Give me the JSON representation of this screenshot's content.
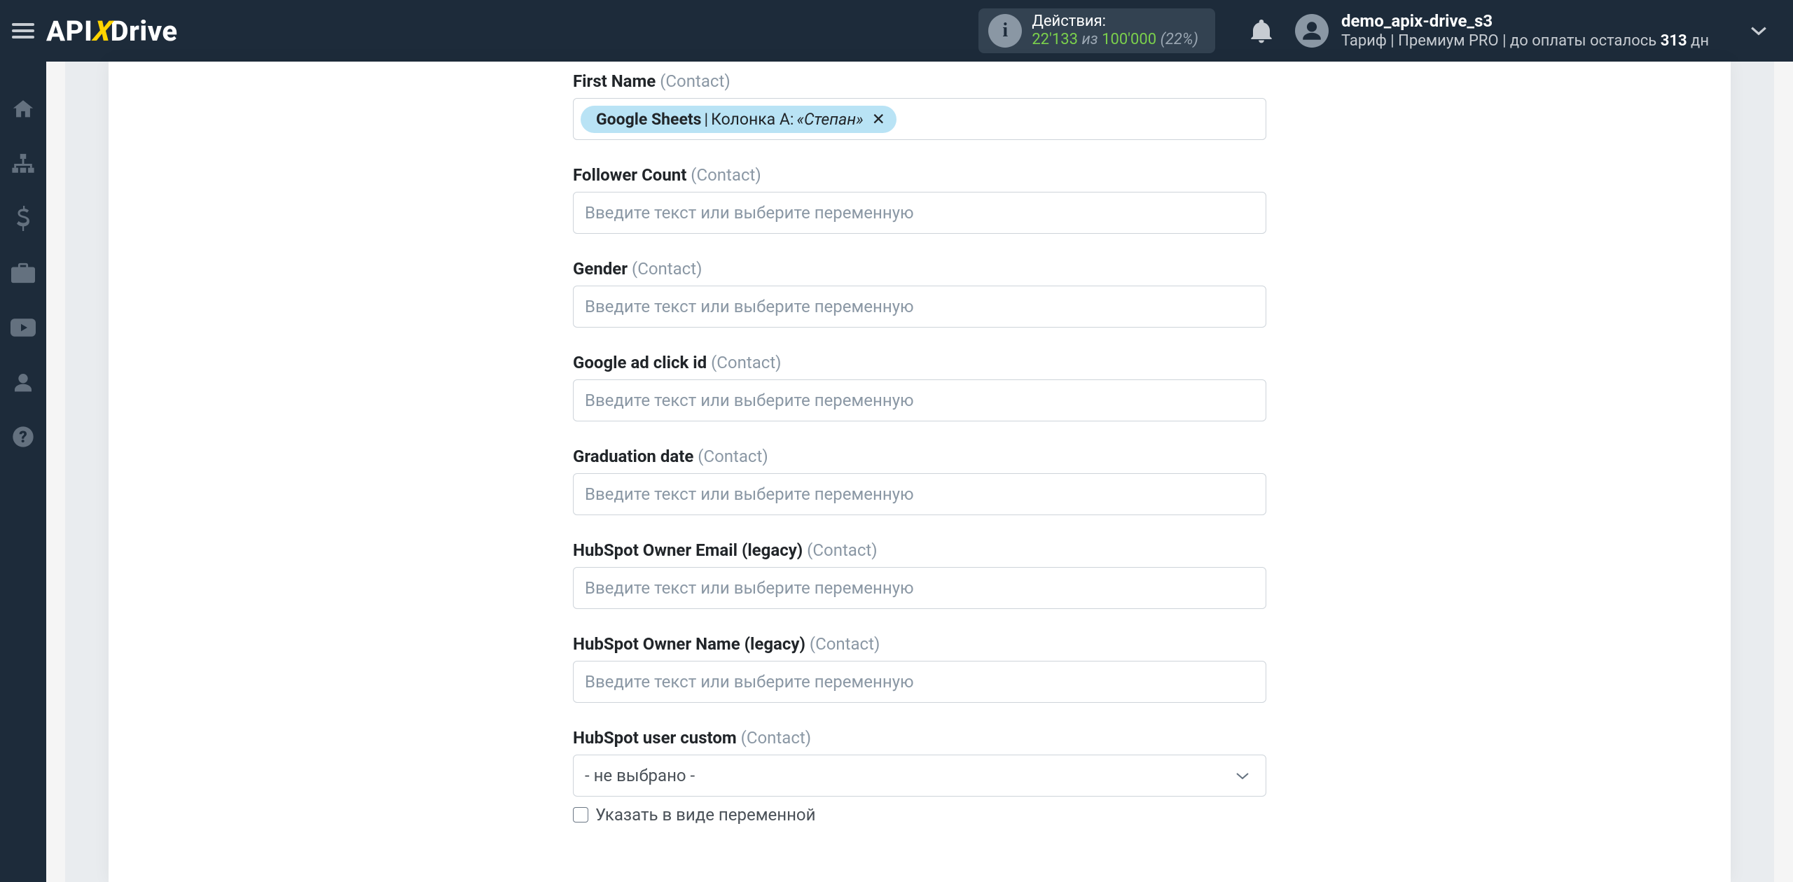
{
  "brand": {
    "api": "API",
    "x": "X",
    "drive": "Drive"
  },
  "header": {
    "actions_label": "Действия:",
    "actions_used": "22'133",
    "actions_of_word": "из",
    "actions_total": "100'000",
    "actions_pct": "(22%)",
    "user_name": "demo_apix-drive_s3",
    "tariff_prefix": "Тариф | ",
    "tariff_plan": "Премиум PRO",
    "tariff_mid": " |  до оплаты осталось ",
    "tariff_days_number": "313",
    "tariff_days_suffix": " дн"
  },
  "icons": {
    "info": "info-icon",
    "bell": "bell-icon",
    "user": "user-icon",
    "chevron_down": "chevron-down-icon",
    "hamburger": "hamburger-icon",
    "rail": [
      "home-icon",
      "sitemap-icon",
      "dollar-icon",
      "briefcase-icon",
      "youtube-icon",
      "user-icon",
      "question-icon"
    ]
  },
  "form": {
    "placeholder_text": "Введите текст или выберите переменную",
    "fields": [
      {
        "label": "First Name",
        "suffix": "(Contact)",
        "kind": "token",
        "token": {
          "source": "Google Sheets",
          "column": "Колонка A:",
          "value": "«Степан»"
        }
      },
      {
        "label": "Follower Count",
        "suffix": "(Contact)",
        "kind": "text"
      },
      {
        "label": "Gender",
        "suffix": "(Contact)",
        "kind": "text"
      },
      {
        "label": "Google ad click id",
        "suffix": "(Contact)",
        "kind": "text"
      },
      {
        "label": "Graduation date",
        "suffix": "(Contact)",
        "kind": "text"
      },
      {
        "label": "HubSpot Owner Email (legacy)",
        "suffix": "(Contact)",
        "kind": "text"
      },
      {
        "label": "HubSpot Owner Name (legacy)",
        "suffix": "(Contact)",
        "kind": "text"
      },
      {
        "label": "HubSpot user custom",
        "suffix": "(Contact)",
        "kind": "select",
        "selected": "- не выбрано -",
        "checkbox_label": "Указать в виде переменной"
      }
    ]
  }
}
